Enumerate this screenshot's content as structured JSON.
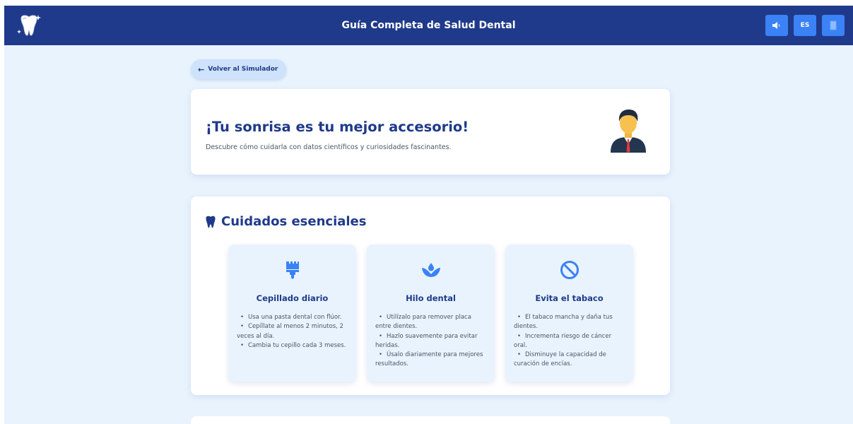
{
  "header": {
    "title": "Guía Completa de Salud Dental",
    "logo_icon": "tooth-sparkle-icon",
    "actions": [
      {
        "name": "audio-button",
        "icon": "speaker-icon",
        "label": ""
      },
      {
        "name": "language-button",
        "icon": "",
        "label": "ES"
      },
      {
        "name": "book-button",
        "icon": "book-icon",
        "label": ""
      }
    ]
  },
  "back_button": {
    "label": "Volver al Simulador",
    "icon": "arrow-left-icon"
  },
  "hero": {
    "title": "¡Tu sonrisa es tu mejor accesorio!",
    "subtitle": "Descubre cómo cuidarla con datos científicos y curiosidades fascinantes.",
    "image_icon": "businessman-avatar-icon"
  },
  "essentials": {
    "title": "Cuidados esenciales",
    "icon": "tooth-icon",
    "cards": [
      {
        "icon": "paint-brush-icon",
        "title": "Cepillado diario",
        "items": [
          "Usa una pasta dental con flúor.",
          "Cepíllate al menos 2 minutos, 2 veces al día.",
          "Cambia tu cepillo cada 3 meses."
        ]
      },
      {
        "icon": "hand-holding-water-icon",
        "title": "Hilo dental",
        "items": [
          "Utilízalo para remover placa entre dientes.",
          "Hazlo suavemente para evitar heridas.",
          "Úsalo diariamente para mejores resultados."
        ]
      },
      {
        "icon": "ban-icon",
        "title": "Evita el tabaco",
        "items": [
          "El tabaco mancha y daña tus dientes.",
          "Incrementa riesgo de cáncer oral.",
          "Disminuye la capacidad de curación de encías."
        ]
      }
    ]
  },
  "colors": {
    "primary": "#1f3a8a",
    "accent": "#3b82f6",
    "background": "#e8f3fd",
    "card": "#e9f3fe"
  }
}
